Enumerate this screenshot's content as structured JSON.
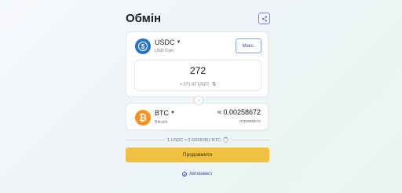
{
  "header": {
    "title": "Обмін",
    "share_icon": "share-icon"
  },
  "from": {
    "ticker": "USDC",
    "name": "USD Coin",
    "max_label": "Макс.",
    "amount": "272",
    "equivalent": "≈ 271.97 USDT",
    "coin_color": "#2775ca"
  },
  "to": {
    "ticker": "BTC",
    "name": "Bitcoin",
    "amount": "≈ 0.00258672",
    "receive_label": "отримаєте",
    "coin_color": "#f7931a"
  },
  "rate": {
    "text": "1 USDC ≈ 0.00000951 BTC"
  },
  "actions": {
    "continue_label": "Продовжити",
    "autoinvest_label": "Автоінвест"
  }
}
